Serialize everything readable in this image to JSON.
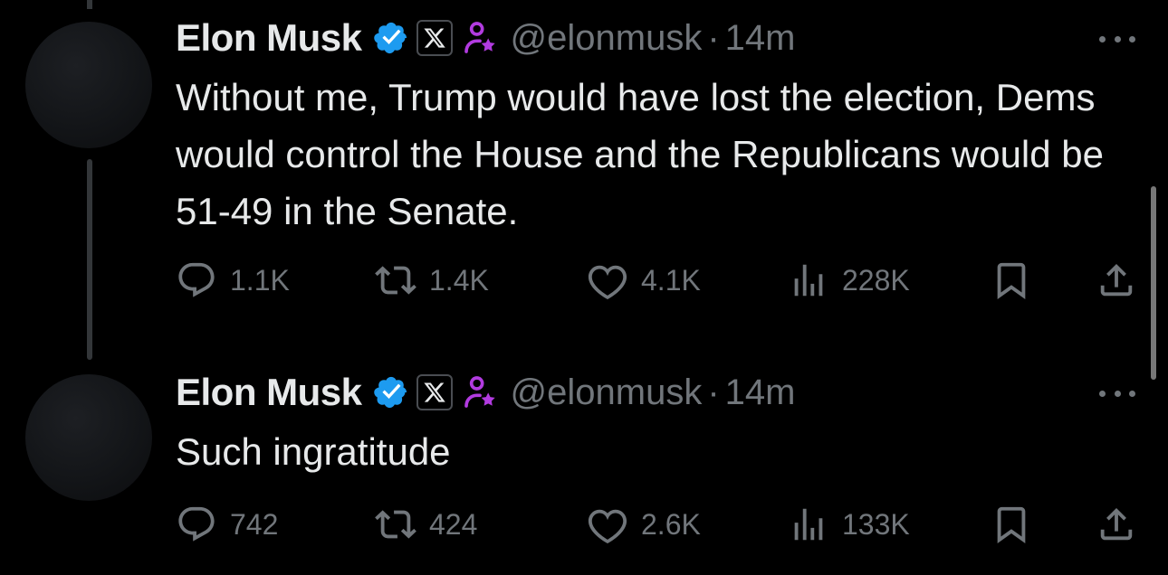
{
  "colors": {
    "background": "#000000",
    "text": "#e7e9ea",
    "muted": "#71767b",
    "verified_blue": "#1d9bf0",
    "affiliate_purple": "#b23be0"
  },
  "tweets": [
    {
      "author": {
        "name": "Elon Musk",
        "handle": "@elonmusk",
        "separator": "·",
        "time": "14m",
        "badges": [
          "verified-badge-icon",
          "x-affiliate-badge-icon",
          "government-affiliate-icon"
        ]
      },
      "text": "Without me, Trump would have lost the election, Dems would control the House and the Republicans would be 51-49 in the Senate.",
      "stats": {
        "replies": "1.1K",
        "reposts": "1.4K",
        "likes": "4.1K",
        "views": "228K"
      }
    },
    {
      "author": {
        "name": "Elon Musk",
        "handle": "@elonmusk",
        "separator": "·",
        "time": "14m",
        "badges": [
          "verified-badge-icon",
          "x-affiliate-badge-icon",
          "government-affiliate-icon"
        ]
      },
      "text": "Such ingratitude",
      "stats": {
        "replies": "742",
        "reposts": "424",
        "likes": "2.6K",
        "views": "133K"
      }
    }
  ]
}
